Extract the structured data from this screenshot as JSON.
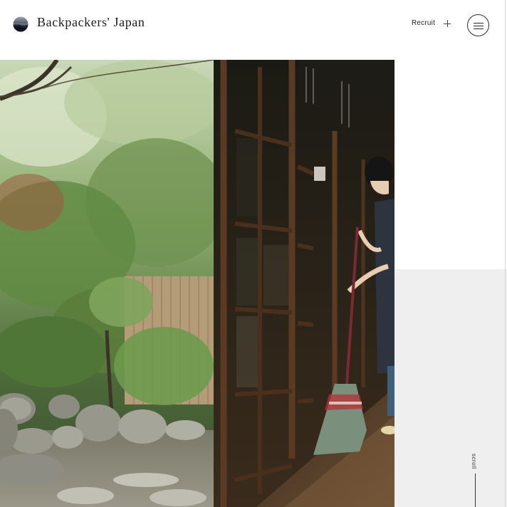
{
  "header": {
    "brand": "Backpackers' Japan",
    "logo_icon": "moon-landscape-logo-icon",
    "nav": {
      "recruit_label": "Recruit",
      "plus_icon": "plus-icon"
    },
    "menu_icon": "hamburger-menu-icon"
  },
  "hero": {
    "image_subject": "hero-photo-icon"
  },
  "side": {
    "scroll_label": "scroll"
  },
  "colors": {
    "text": "#1c1c1c",
    "panel_gray": "#efefef",
    "background": "#ffffff"
  }
}
